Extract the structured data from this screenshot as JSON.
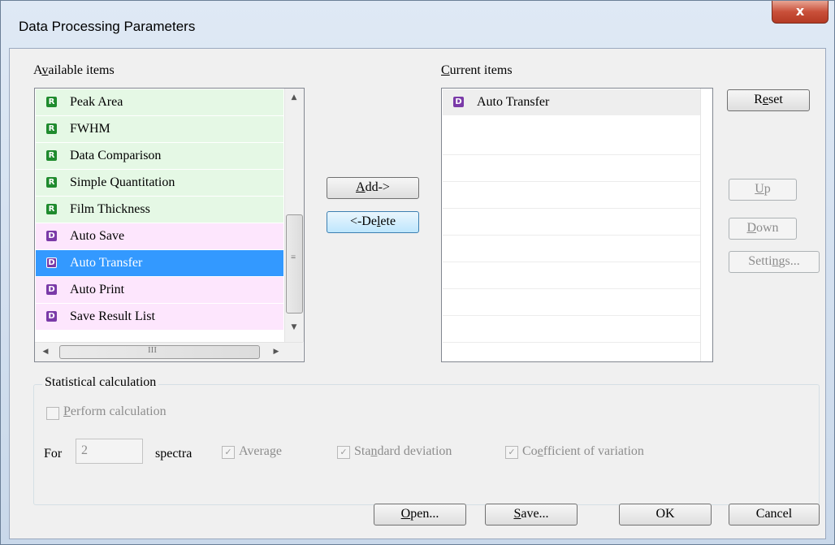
{
  "window": {
    "title": "Data Processing Parameters",
    "close_glyph": "x"
  },
  "available": {
    "label_pre": "A",
    "label_u": "v",
    "label_post": "ailable items",
    "items": [
      {
        "kind": "R",
        "label": "Peak Area"
      },
      {
        "kind": "R",
        "label": "FWHM"
      },
      {
        "kind": "R",
        "label": "Data Comparison"
      },
      {
        "kind": "R",
        "label": "Simple Quantitation"
      },
      {
        "kind": "R",
        "label": "Film Thickness"
      },
      {
        "kind": "D",
        "label": "Auto Save"
      },
      {
        "kind": "D",
        "label": "Auto Transfer"
      },
      {
        "kind": "D",
        "label": "Auto Print"
      },
      {
        "kind": "D",
        "label": "Save Result List"
      }
    ],
    "scroll_grip": "≡",
    "hscroll_grip": "III"
  },
  "current": {
    "label_u": "C",
    "label_post": "urrent items",
    "items": [
      {
        "kind": "D",
        "label": "Auto Transfer"
      }
    ]
  },
  "middle": {
    "add_u": "A",
    "add_post": "dd->",
    "delete_pre": "<-De",
    "delete_u": "l",
    "delete_post": "ete"
  },
  "side": {
    "reset_pre": "R",
    "reset_u": "e",
    "reset_post": "set",
    "up_u": "U",
    "up_post": "p",
    "down_u": "D",
    "down_post": "own",
    "settings_pre": "Setti",
    "settings_u": "n",
    "settings_post": "gs..."
  },
  "stats": {
    "title": "Statistical calculation",
    "perform_u": "P",
    "perform_post": "erform calculation",
    "for_label": "For",
    "spectra_value": "2",
    "spectra_label": "spectra",
    "average_label": "Average",
    "stddev_pre": "Sta",
    "stddev_u": "n",
    "stddev_post": "dard deviation",
    "cv_pre": "Co",
    "cv_u": "e",
    "cv_post": "fficient of variation",
    "check_glyph": "✓"
  },
  "footer": {
    "open_u": "O",
    "open_post": "pen...",
    "save_u": "S",
    "save_post": "ave...",
    "ok_label": "OK",
    "cancel_label": "Cancel"
  },
  "colors": {
    "r_badge": "#1f8b2e",
    "d_badge": "#7a3aa8",
    "selection": "#3399ff"
  }
}
